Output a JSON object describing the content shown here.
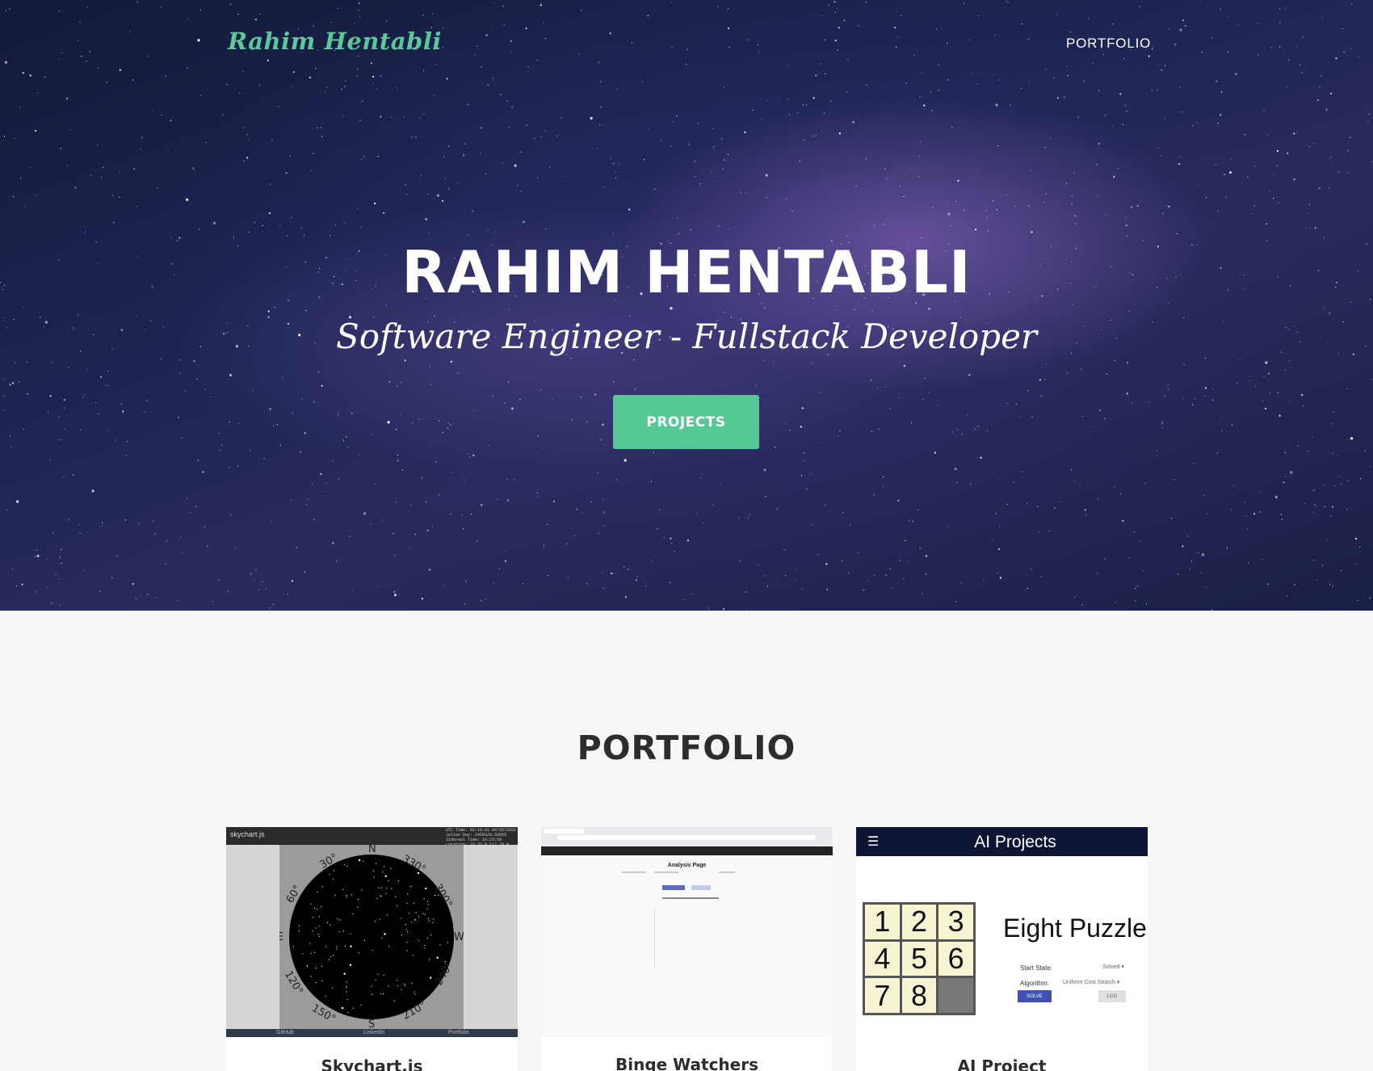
{
  "header": {
    "brand": "Rahim Hentabli",
    "nav": [
      {
        "label": "PORTFOLIO"
      }
    ]
  },
  "hero": {
    "title": "RAHIM HENTABLI",
    "subtitle": "Software Engineer - Fullstack Developer",
    "button_label": "PROJECTS"
  },
  "portfolio": {
    "title": "PORTFOLIO",
    "cards": [
      {
        "caption": "Skychart.js",
        "thumb": {
          "app_name": "skychart.js",
          "info_lines": [
            "UTC Time:    02:19:01 04/25/2021",
            "Julian Day:    2459329.59655",
            "Sidereal Time:    10:23:59",
            "Location:    33.37 N 117.29 W"
          ],
          "compass": [
            "N",
            "S",
            "E",
            "W",
            "30°",
            "60°",
            "120°",
            "150°",
            "210°",
            "240°",
            "300°",
            "330°"
          ],
          "footer_links": [
            "GitHub",
            "LinkedIn",
            "Portfolio"
          ]
        }
      },
      {
        "caption": "Binge Watchers",
        "thumb": {
          "page_title": "Analysis Page"
        }
      },
      {
        "caption": "AI Project",
        "thumb": {
          "menu_icon": "hamburger-icon",
          "header": "AI Projects",
          "puzzle_title": "Eight Puzzle",
          "tiles": [
            "1",
            "2",
            "3",
            "4",
            "5",
            "6",
            "7",
            "8",
            ""
          ],
          "start_state_label": "Start State:",
          "start_state_value": "Solved ▾",
          "algorithm_label": "Algorithm:",
          "algorithm_value": "Uniform Cost Search ▾",
          "solve_label": "SOLVE",
          "log_label": "LOG"
        }
      }
    ]
  },
  "colors": {
    "accent": "#55c895",
    "brand": "#5ac99a",
    "heading": "#2d2d2d",
    "section_bg": "#f7f7f7"
  }
}
